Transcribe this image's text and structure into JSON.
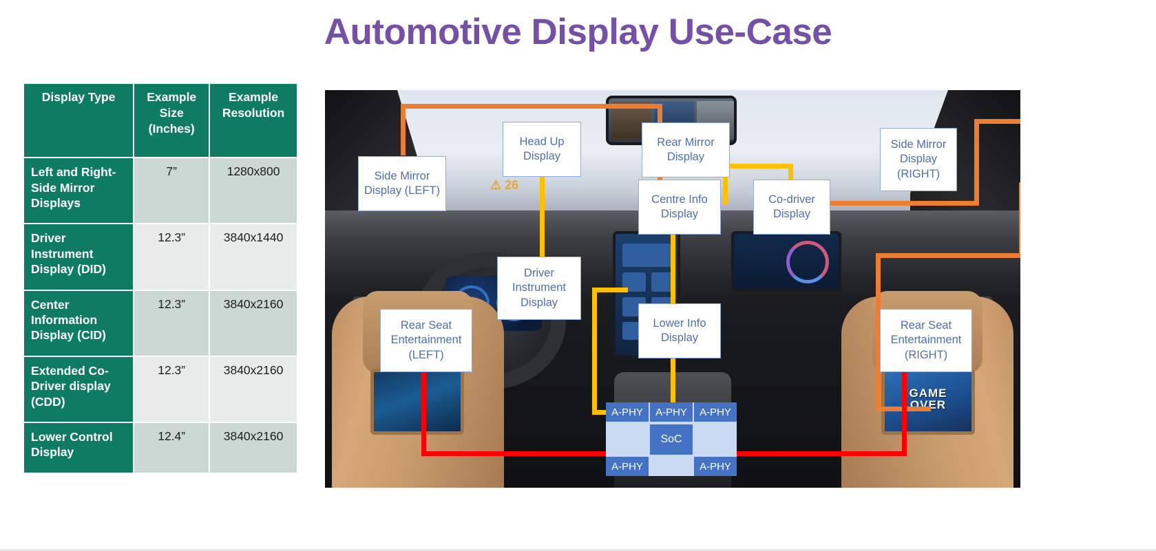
{
  "page": {
    "title": "Automotive Display Use-Case",
    "title_color": "#7450A8"
  },
  "table": {
    "headers": [
      "Display Type",
      "Example Size (Inches)",
      "Example Resolution"
    ],
    "header_lines": {
      "col0": "Display Type",
      "col1_line1": "Example",
      "col1_line2": "Size",
      "col1_line3": "(Inches)",
      "col2_line1": "Example",
      "col2_line2": "Resolution"
    },
    "header_bg": "#0E7C62",
    "rows": [
      {
        "type": "Left and Right-Side Mirror Displays",
        "size": "7”",
        "resolution": "1280x800"
      },
      {
        "type": "Driver Instrument Display (DID)",
        "size": "12.3”",
        "resolution": "3840x1440"
      },
      {
        "type": "Center Information Display (CID)",
        "size": "12.3”",
        "resolution": "3840x2160"
      },
      {
        "type": "Extended Co-Driver display (CDD)",
        "size": "12.3”",
        "resolution": "3840x2160"
      },
      {
        "type": "Lower Control Display",
        "size": "12.4”",
        "resolution": "3840x2160"
      }
    ]
  },
  "figure": {
    "hud_readout": "26",
    "rear_screen_right_text_line1": "GAME",
    "rear_screen_right_text_line2": "OVER",
    "callouts": [
      {
        "id": "side-mirror-left",
        "line1": "Side Mirror",
        "line2": "Display (LEFT)",
        "line3": ""
      },
      {
        "id": "head-up-display",
        "line1": "Head Up",
        "line2": "Display",
        "line3": ""
      },
      {
        "id": "rear-mirror-display",
        "line1": "Rear Mirror",
        "line2": "Display",
        "line3": ""
      },
      {
        "id": "side-mirror-right",
        "line1": "Side Mirror",
        "line2": "Display",
        "line3": "(RIGHT)"
      },
      {
        "id": "centre-info-display",
        "line1": "Centre Info",
        "line2": "Display",
        "line3": ""
      },
      {
        "id": "co-driver-display",
        "line1": "Co-driver",
        "line2": "Display",
        "line3": ""
      },
      {
        "id": "driver-instrument",
        "line1": "Driver",
        "line2": "Instrument",
        "line3": "Display"
      },
      {
        "id": "lower-info-display",
        "line1": "Lower Info",
        "line2": "Display",
        "line3": ""
      },
      {
        "id": "rear-seat-left",
        "line1": "Rear Seat",
        "line2": "Entertainment",
        "line3": "(LEFT)"
      },
      {
        "id": "rear-seat-right",
        "line1": "Rear Seat",
        "line2": "Entertainment",
        "line3": "(RIGHT)"
      }
    ],
    "soc_block": {
      "core_label": "SoC",
      "aphy_label": "A-PHY",
      "aphy_top": [
        "A-PHY",
        "A-PHY",
        "A-PHY"
      ],
      "aphy_bottom": [
        "A-PHY",
        "A-PHY"
      ],
      "box_color": "#4472C4",
      "panel_color": "#C9DAF2"
    },
    "link_colors": {
      "orange": "#ED7D31",
      "yellow": "#FFC000",
      "red": "#FF0000"
    }
  }
}
